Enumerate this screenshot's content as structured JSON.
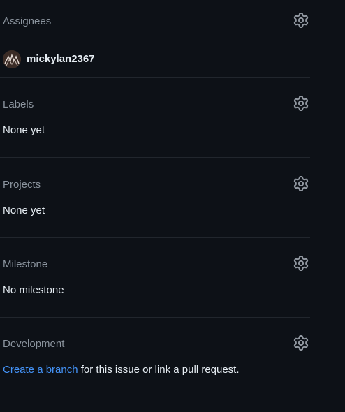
{
  "assignees": {
    "title": "Assignees",
    "gear_icon": "gear-icon",
    "users": [
      {
        "username": "mickylan2367",
        "avatar_icon": "avatar-image"
      }
    ]
  },
  "labels": {
    "title": "Labels",
    "gear_icon": "gear-icon",
    "value": "None yet"
  },
  "projects": {
    "title": "Projects",
    "gear_icon": "gear-icon",
    "value": "None yet"
  },
  "milestone": {
    "title": "Milestone",
    "gear_icon": "gear-icon",
    "value": "No milestone"
  },
  "development": {
    "title": "Development",
    "gear_icon": "gear-icon",
    "link_text": "Create a branch",
    "suffix_text": " for this issue or link a pull request."
  },
  "colors": {
    "background": "#0d1117",
    "heading": "#8b949e",
    "text": "#e6edf3",
    "link": "#4493f8",
    "divider": "#21262d",
    "icon": "#9198a1"
  }
}
